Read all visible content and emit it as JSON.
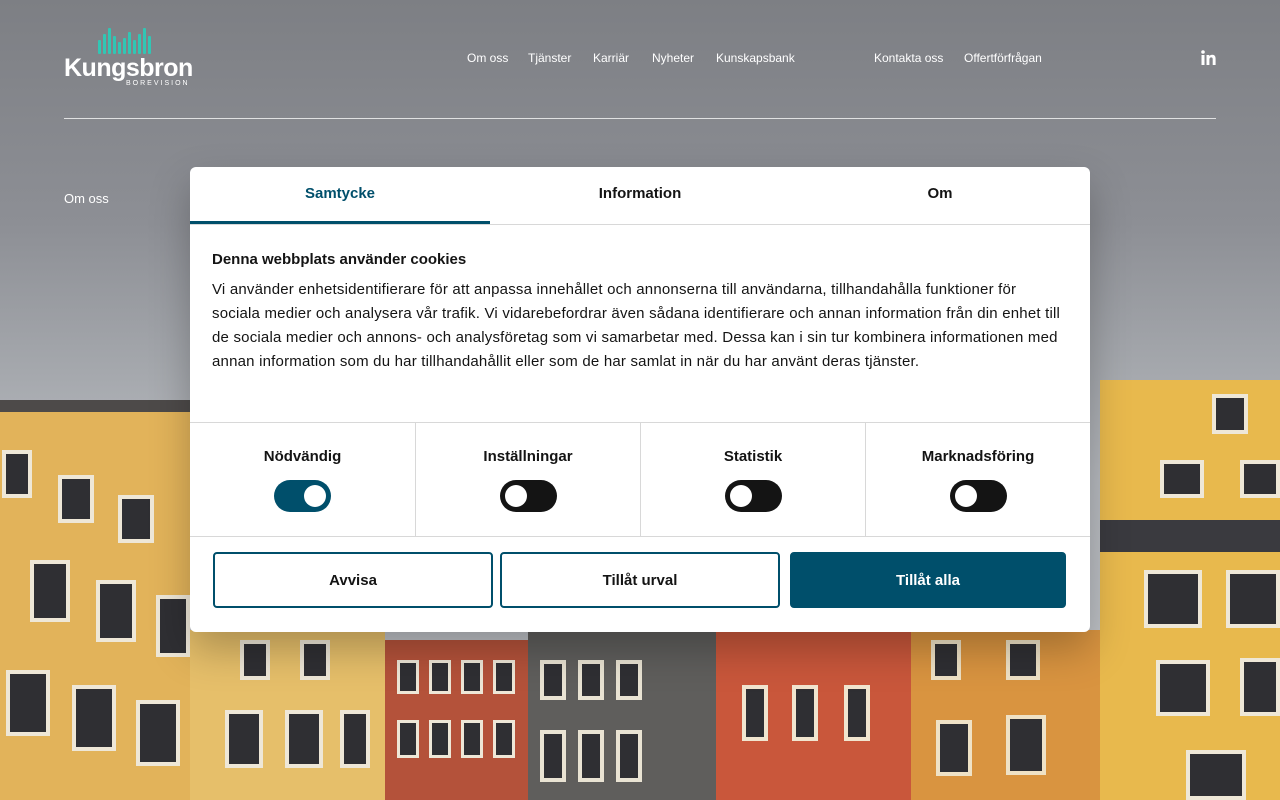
{
  "header": {
    "logo_text": "Kungsbron",
    "logo_subtext": "BOREVISION",
    "nav_main": [
      "Om oss",
      "Tjänster",
      "Karriär",
      "Nyheter",
      "Kunskapsbank"
    ],
    "nav_secondary": [
      "Kontakta oss",
      "Offertförfrågan"
    ],
    "social_icon": "linkedin-icon"
  },
  "breadcrumb": "Om oss",
  "dialog": {
    "tabs": [
      {
        "label": "Samtycke",
        "active": true
      },
      {
        "label": "Information",
        "active": false
      },
      {
        "label": "Om",
        "active": false
      }
    ],
    "title": "Denna webbplats använder cookies",
    "body": "Vi använder enhetsidentifierare för att anpassa innehållet och annonserna till användarna, tillhandahålla funktioner för sociala medier och analysera vår trafik. Vi vidarebefordrar även sådana identifierare och annan information från din enhet till de sociala medier och annons- och analysföretag som vi samarbetar med. Dessa kan i sin tur kombinera informationen med annan information som du har tillhandahållit eller som de har samlat in när du har använt deras tjänster.",
    "categories": [
      {
        "label": "Nödvändig",
        "enabled": true
      },
      {
        "label": "Inställningar",
        "enabled": false
      },
      {
        "label": "Statistik",
        "enabled": false
      },
      {
        "label": "Marknadsföring",
        "enabled": false
      }
    ],
    "buttons": {
      "reject": "Avvisa",
      "allow_selection": "Tillåt urval",
      "allow_all": "Tillåt alla"
    }
  },
  "colors": {
    "accent": "#004f6b",
    "logo_accent": "#31c6b4",
    "toggle_off": "#141414"
  }
}
